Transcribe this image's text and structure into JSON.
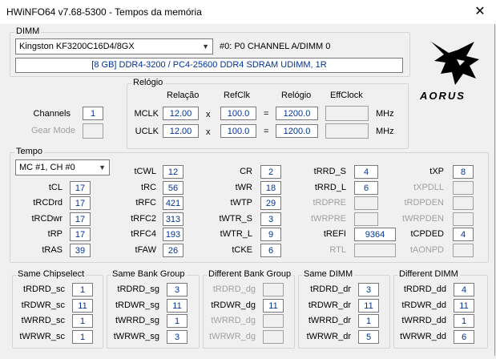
{
  "window": {
    "title": "HWiNFO64 v7.68-5300 - Tempos da memória",
    "close": "✕"
  },
  "dimm": {
    "legend": "DIMM",
    "selected": "Kingston KF3200C16D4/8GX",
    "slot": "#0: P0 CHANNEL A/DIMM 0",
    "info": "[8 GB] DDR4-3200 / PC4-25600 DDR4 SDRAM UDIMM, 1R"
  },
  "logo_text": "AORUS",
  "channels": {
    "label": "Channels",
    "value": "1",
    "gear_label": "Gear Mode",
    "gear_value": ""
  },
  "clock": {
    "legend": "Relógio",
    "headers": {
      "ratio": "Relação",
      "refclk": "RefClk",
      "clock": "Relógio",
      "effclock": "EffClock"
    },
    "rows": [
      {
        "label": "MCLK",
        "ratio": "12.00",
        "x": "x",
        "refclk": "100.0",
        "eq": "=",
        "clock": "1200.0",
        "eff": "",
        "unit": "MHz"
      },
      {
        "label": "UCLK",
        "ratio": "12.00",
        "x": "x",
        "refclk": "100.0",
        "eq": "=",
        "clock": "1200.0",
        "eff": "",
        "unit": "MHz"
      }
    ]
  },
  "timing": {
    "legend": "Tempo",
    "selected": "MC #1, CH #0",
    "col1": [
      {
        "label": "tCL",
        "value": "17"
      },
      {
        "label": "tRCDrd",
        "value": "17"
      },
      {
        "label": "tRCDwr",
        "value": "17"
      },
      {
        "label": "tRP",
        "value": "17"
      },
      {
        "label": "tRAS",
        "value": "39"
      }
    ],
    "col2": [
      {
        "label": "tCWL",
        "value": "12"
      },
      {
        "label": "tRC",
        "value": "56"
      },
      {
        "label": "tRFC",
        "value": "421"
      },
      {
        "label": "tRFC2",
        "value": "313"
      },
      {
        "label": "tRFC4",
        "value": "193"
      },
      {
        "label": "tFAW",
        "value": "26"
      }
    ],
    "col3": [
      {
        "label": "CR",
        "value": "2"
      },
      {
        "label": "tWR",
        "value": "18"
      },
      {
        "label": "tWTP",
        "value": "29"
      },
      {
        "label": "tWTR_S",
        "value": "3"
      },
      {
        "label": "tWTR_L",
        "value": "9"
      },
      {
        "label": "tCKE",
        "value": "6"
      }
    ],
    "col4": [
      {
        "label": "tRRD_S",
        "value": "4"
      },
      {
        "label": "tRRD_L",
        "value": "6"
      },
      {
        "label": "tRDPRE",
        "value": ""
      },
      {
        "label": "tWRPRE",
        "value": ""
      },
      {
        "label": "tREFI",
        "value": "9364"
      },
      {
        "label": "RTL",
        "value": ""
      }
    ],
    "col5": [
      {
        "label": "tXP",
        "value": "8"
      },
      {
        "label": "tXPDLL",
        "value": ""
      },
      {
        "label": "tRDPDEN",
        "value": ""
      },
      {
        "label": "tWRPDEN",
        "value": ""
      },
      {
        "label": "tCPDED",
        "value": "4"
      },
      {
        "label": "tAONPD",
        "value": ""
      }
    ]
  },
  "groups": [
    {
      "legend": "Same Chipselect",
      "rows": [
        {
          "label": "tRDRD_sc",
          "value": "1"
        },
        {
          "label": "tRDWR_sc",
          "value": "11"
        },
        {
          "label": "tWRRD_sc",
          "value": "1"
        },
        {
          "label": "tWRWR_sc",
          "value": "1"
        }
      ]
    },
    {
      "legend": "Same Bank Group",
      "rows": [
        {
          "label": "tRDRD_sg",
          "value": "3"
        },
        {
          "label": "tRDWR_sg",
          "value": "11"
        },
        {
          "label": "tWRRD_sg",
          "value": "1"
        },
        {
          "label": "tWRWR_sg",
          "value": "3"
        }
      ]
    },
    {
      "legend": "Different Bank Group",
      "rows": [
        {
          "label": "tRDRD_dg",
          "value": ""
        },
        {
          "label": "tRDWR_dg",
          "value": "11"
        },
        {
          "label": "tWRRD_dg",
          "value": ""
        },
        {
          "label": "tWRWR_dg",
          "value": ""
        }
      ]
    },
    {
      "legend": "Same DIMM",
      "rows": [
        {
          "label": "tRDRD_dr",
          "value": "3"
        },
        {
          "label": "tRDWR_dr",
          "value": "11"
        },
        {
          "label": "tWRRD_dr",
          "value": "1"
        },
        {
          "label": "tWRWR_dr",
          "value": "5"
        }
      ]
    },
    {
      "legend": "Different DIMM",
      "rows": [
        {
          "label": "tRDRD_dd",
          "value": "4"
        },
        {
          "label": "tRDWR_dd",
          "value": "11"
        },
        {
          "label": "tWRRD_dd",
          "value": "1"
        },
        {
          "label": "tWRWR_dd",
          "value": "6"
        }
      ]
    }
  ]
}
